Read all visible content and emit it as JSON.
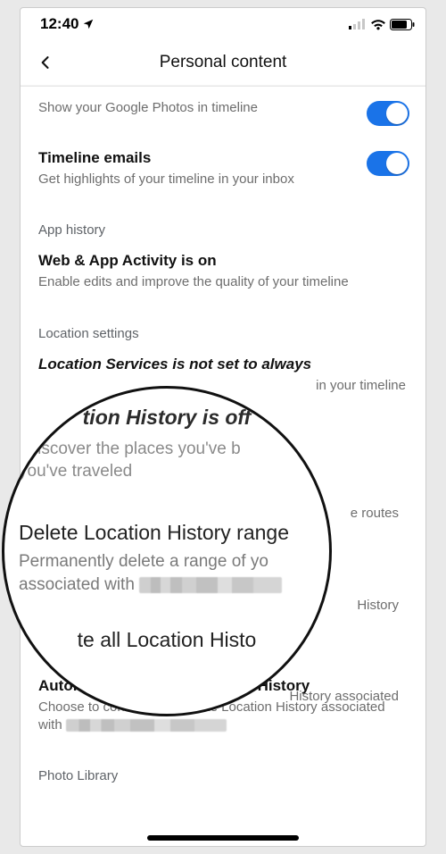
{
  "status": {
    "time": "12:40"
  },
  "header": {
    "title": "Personal content"
  },
  "rows": {
    "photos": {
      "sub": "Show your Google Photos in timeline"
    },
    "timeline_emails": {
      "title": "Timeline emails",
      "sub": "Get highlights of your timeline in your inbox"
    },
    "app_history_label": "App history",
    "web_app": {
      "title": "Web & App Activity is on",
      "sub": "Enable edits and improve the quality of your timeline"
    },
    "location_settings_label": "Location settings",
    "loc_services": {
      "title": "Location Services is not set to always",
      "sub_frag": "in your timeline"
    },
    "peek_routes": "e routes",
    "peek_history1": "History",
    "peek_history2": "History associated",
    "auto_delete": {
      "title": "Automatically delete Location History",
      "sub_pre": "Choose to continuously delete Location History associated with "
    },
    "photo_library_label": "Photo Library"
  },
  "magnifier": {
    "top_partial": "tion History is off",
    "top_sub_line1": "ediscover the places you've b",
    "top_sub_line2": "you've traveled",
    "h1": "Delete Location History range",
    "h1_sub_line1": "Permanently delete a range of yo",
    "h1_sub_line2_pre": "associated with ",
    "h2": "te all Location Histo"
  }
}
